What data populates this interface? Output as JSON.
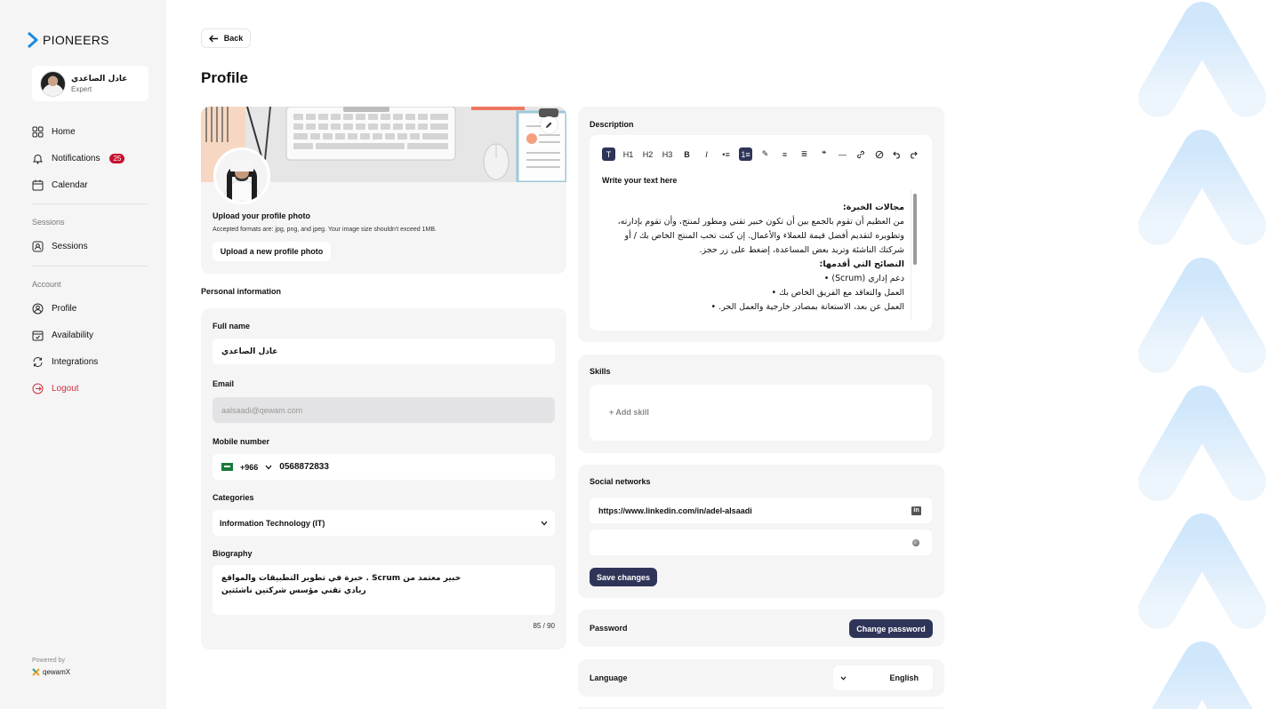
{
  "brand": {
    "name": "PIONEERS"
  },
  "user": {
    "name": "عادل الصاعدي",
    "role": "Expert"
  },
  "nav": {
    "home": "Home",
    "notifications": "Notifications",
    "notifications_count": "25",
    "calendar": "Calendar",
    "sessions_section": "Sessions",
    "sessions": "Sessions",
    "account_section": "Account",
    "profile": "Profile",
    "availability": "Availability",
    "integrations": "Integrations",
    "logout": "Logout"
  },
  "footer": {
    "powered_by": "Powered by",
    "powered_brand": "qewamX"
  },
  "header": {
    "back": "Back",
    "title": "Profile"
  },
  "photo": {
    "title": "Upload your profile photo",
    "hint": "Accepted formats are: jpg, png, and jpeg. Your image size shouldn't exceed 1MB.",
    "upload_button": "Upload a new profile photo"
  },
  "personal": {
    "section_title": "Personal information",
    "full_name_label": "Full name",
    "full_name_value": "عادل الصاعدي",
    "email_label": "Email",
    "email_value": "aalsaadi@qewam.com",
    "mobile_label": "Mobile number",
    "country_code": "+966",
    "mobile_value": "0568872833",
    "categories_label": "Categories",
    "categories_value": "Information Technology (IT)",
    "bio_label": "Biography",
    "bio_line1": "خبرة في تطوير التطبيقات والمواقع . Scrum خبير معتمد من",
    "bio_line2": "ريادي تقني مؤسس شركتين ناشئتين",
    "bio_counter": "85 / 90"
  },
  "description": {
    "label": "Description",
    "toolbar": [
      "T",
      "H1",
      "H2",
      "H3",
      "B",
      "I",
      "•≡",
      "1≡",
      "✎",
      "≡",
      "≣",
      "❝",
      "—",
      "🔗",
      "⊘",
      "↶",
      "↷"
    ],
    "placeholder_heading": "Write your text here",
    "heading1": "مجالات الخبرة:",
    "para1": "من العظيم أن تقوم بالجمع بين أن تكون  خبير تقني ومطور لمنتج، وأن تقوم بإدارته، وتطويره لتقديم أفضل قيمة للعملاء والأعمال. إن كنت تحب المنتج الخاص بك / أو شركتك الناشئة وتريد بعض المساعدة، إضغط على زر حجز.",
    "heading2": "النصائح التي أقدمها:",
    "bullets": [
      "دعم إداري (Scrum)",
      "العمل والتعاقد مع الفريق الخاص بك",
      "العمل عن بعد، الاستعانة بمصادر خارجية والعمل الحر."
    ]
  },
  "skills": {
    "label": "Skills",
    "add": "+ Add skill"
  },
  "social": {
    "label": "Social networks",
    "linkedin": "https://www.linkedin.com/in/adel-alsaadi",
    "linkedin_icon": "in",
    "save": "Save changes"
  },
  "password": {
    "label": "Password",
    "button": "Change password"
  },
  "language": {
    "label": "Language",
    "value": "English"
  },
  "colors": {
    "accent": "#2f3558",
    "danger": "#c8102e",
    "panel": "#f5f5f6",
    "brand_blue": "#1e88e5"
  }
}
